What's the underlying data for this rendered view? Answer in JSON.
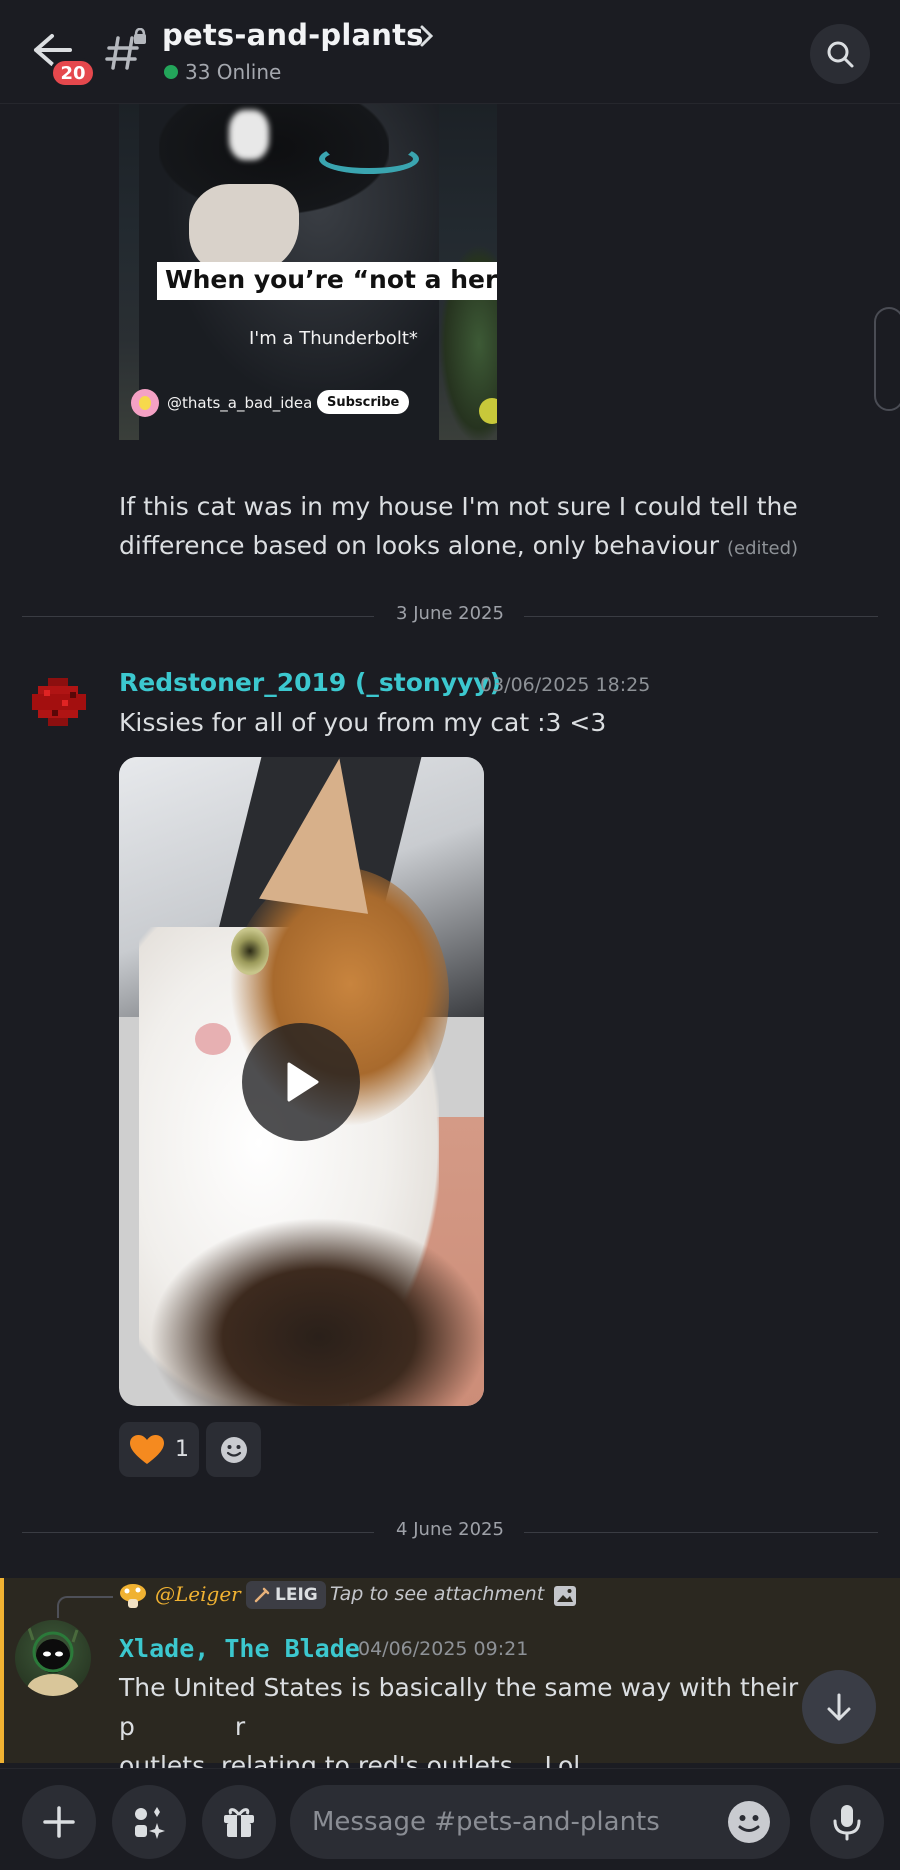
{
  "header": {
    "unread_badge": "20",
    "channel_name": "pets-and-plants",
    "online_count": "33 Online"
  },
  "embed": {
    "caption": "When you’re “not a hero”",
    "sub_caption": "I'm a Thunderbolt*",
    "handle": "@thats_a_bad_idea",
    "subscribe_label": "Subscribe"
  },
  "messages": [
    {
      "text_line1": "If this cat was in my house I'm not sure I could tell the",
      "text_line2": "difference based on looks alone, only behaviour",
      "edited": "(edited)"
    },
    {
      "username": "Redstoner_2019 (_stonyyy)",
      "username_color": "#3cc8cf",
      "timestamp": "03/06/2025 18:25",
      "text": "Kissies for all of you from my cat :3 <3",
      "reactions": [
        {
          "emoji": "orange-heart",
          "count": "1"
        }
      ]
    },
    {
      "reply_to": {
        "name": "@Leiger",
        "tag": "LEIG",
        "text": "Tap to see attachment"
      },
      "username": "Xlade, The Blade",
      "username_color": "#3cc8cf",
      "timestamp": "04/06/2025 09:21",
      "text_line1": "The United States is basically the same way with their p",
      "text_line1_tail": "r",
      "text_line2": "outlets, relating to red's outlets... Lol"
    }
  ],
  "dividers": {
    "first": "3 June 2025",
    "second": "4 June 2025"
  },
  "composer": {
    "placeholder": "Message #pets-and-plants"
  },
  "colors": {
    "background": "#1b1c22",
    "accent_highlight": "#f0b232",
    "reaction_heart": "#f58a1f",
    "online": "#23a55a"
  }
}
